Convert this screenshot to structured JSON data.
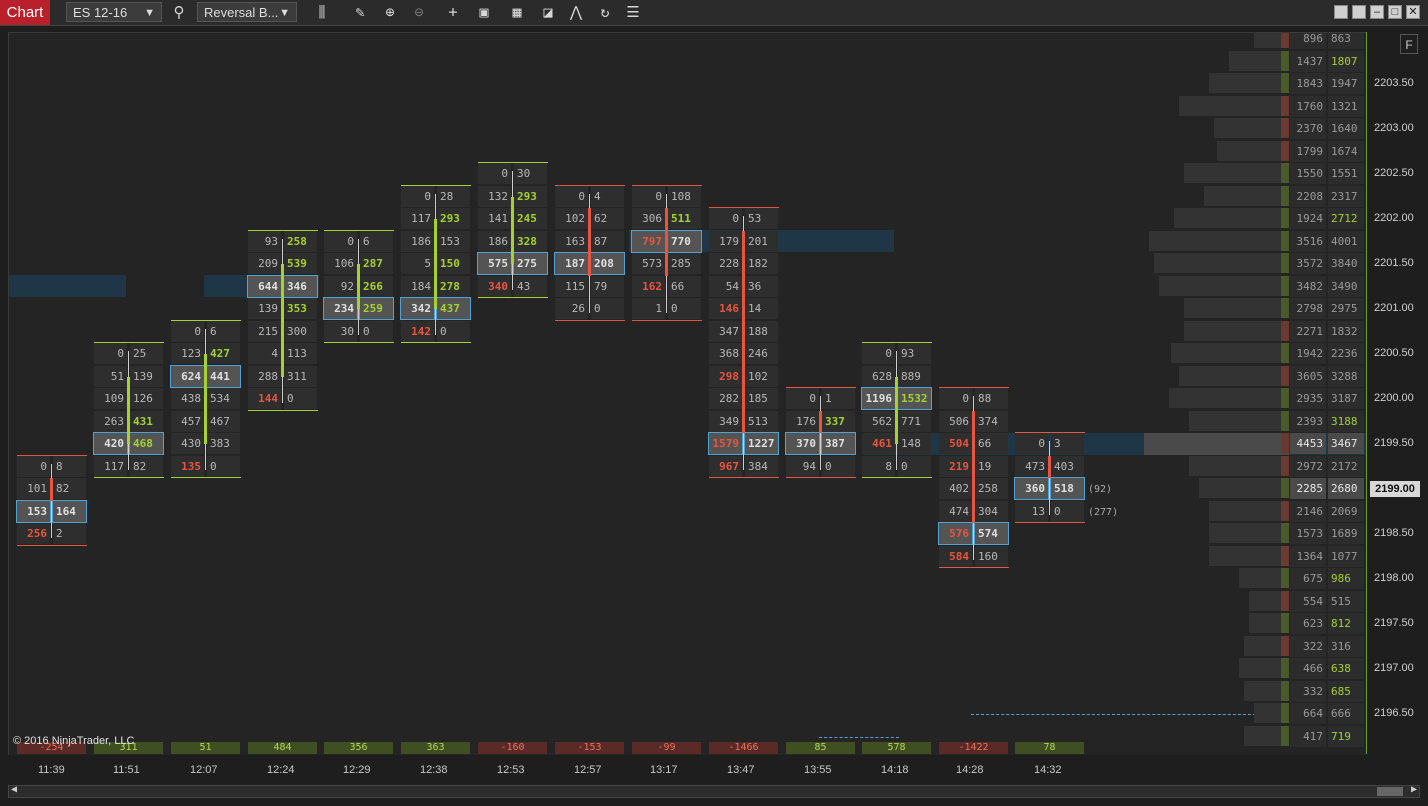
{
  "toolbar": {
    "tab_label": "Chart",
    "instrument": "ES 12-16",
    "bar_type": "Reversal B...",
    "tools": [
      "search-icon",
      "bar-chart-icon",
      "pencil-icon",
      "zoom-in-icon",
      "zoom-out-icon",
      "crosshair-icon",
      "data-box-icon",
      "chart-style-icon",
      "templates-icon",
      "strategy-icon",
      "reload-icon",
      "properties-icon"
    ]
  },
  "right_ctrl": {
    "f_label": "F"
  },
  "copyright": "© 2016 NinjaTrader, LLC",
  "current_price": "2199.00",
  "price_axis": [
    "2203.50",
    "2203.00",
    "2202.50",
    "2202.00",
    "2201.50",
    "2201.00",
    "2200.50",
    "2200.00",
    "2199.50",
    "2198.50",
    "2198.00",
    "2197.50",
    "2197.00",
    "2196.50"
  ],
  "annotations": [
    "(92)",
    "(277)"
  ],
  "colors": {
    "up": "#a6d12e",
    "down": "#e8553e",
    "poc_border": "#4fa2d1",
    "band": "#1e3a4c"
  },
  "bars": [
    {
      "time": "11:39",
      "delta": "-254",
      "dir": "down",
      "rows": [
        [
          "0",
          "8"
        ],
        [
          "101",
          "82"
        ],
        [
          "153",
          "164"
        ],
        [
          "256",
          "2"
        ]
      ],
      "poc": 2
    },
    {
      "time": "11:51",
      "delta": "311",
      "dir": "up",
      "rows": [
        [
          "0",
          "25"
        ],
        [
          "51",
          "139"
        ],
        [
          "109",
          "126"
        ],
        [
          "263",
          "431"
        ],
        [
          "420",
          "468"
        ],
        [
          "117",
          "82"
        ]
      ],
      "poc": 4
    },
    {
      "time": "12:07",
      "delta": "51",
      "dir": "up",
      "rows": [
        [
          "0",
          "6"
        ],
        [
          "123",
          "427"
        ],
        [
          "624",
          "441"
        ],
        [
          "438",
          "534"
        ],
        [
          "457",
          "467"
        ],
        [
          "430",
          "383"
        ],
        [
          "135",
          "0"
        ]
      ],
      "poc": 2
    },
    {
      "time": "12:24",
      "delta": "484",
      "dir": "up",
      "rows": [
        [
          "93",
          "258"
        ],
        [
          "209",
          "539"
        ],
        [
          "644",
          "346"
        ],
        [
          "139",
          "353"
        ],
        [
          "215",
          "300"
        ],
        [
          "4",
          "113"
        ],
        [
          "288",
          "311"
        ],
        [
          "144",
          "0"
        ]
      ],
      "poc": 2
    },
    {
      "time": "12:29",
      "delta": "356",
      "dir": "up",
      "rows": [
        [
          "0",
          "6"
        ],
        [
          "106",
          "287"
        ],
        [
          "92",
          "266"
        ],
        [
          "234",
          "259"
        ],
        [
          "30",
          "0"
        ]
      ],
      "poc": 3
    },
    {
      "time": "12:38",
      "delta": "363",
      "dir": "up",
      "rows": [
        [
          "0",
          "28"
        ],
        [
          "117",
          "293"
        ],
        [
          "186",
          "153"
        ],
        [
          "5",
          "150"
        ],
        [
          "184",
          "278"
        ],
        [
          "342",
          "437"
        ],
        [
          "142",
          "0"
        ]
      ],
      "poc": 5
    },
    {
      "time": "12:53",
      "delta": "-160",
      "dir": "up",
      "rows": [
        [
          "0",
          "30"
        ],
        [
          "132",
          "293"
        ],
        [
          "141",
          "245"
        ],
        [
          "186",
          "328"
        ],
        [
          "575",
          "275"
        ],
        [
          "340",
          "43"
        ]
      ],
      "poc": 4
    },
    {
      "time": "12:57",
      "delta": "-153",
      "dir": "down",
      "rows": [
        [
          "0",
          "4"
        ],
        [
          "102",
          "62"
        ],
        [
          "163",
          "87"
        ],
        [
          "187",
          "208"
        ],
        [
          "115",
          "79"
        ],
        [
          "26",
          "0"
        ]
      ],
      "poc": 3
    },
    {
      "time": "13:17",
      "delta": "-99",
      "dir": "down",
      "rows": [
        [
          "0",
          "108"
        ],
        [
          "306",
          "511"
        ],
        [
          "797",
          "770"
        ],
        [
          "573",
          "285"
        ],
        [
          "162",
          "66"
        ],
        [
          "1",
          "0"
        ]
      ],
      "poc": 2
    },
    {
      "time": "13:47",
      "delta": "-1466",
      "dir": "down",
      "rows": [
        [
          "0",
          "53"
        ],
        [
          "179",
          "201"
        ],
        [
          "228",
          "182"
        ],
        [
          "54",
          "36"
        ],
        [
          "146",
          "14"
        ],
        [
          "347",
          "188"
        ],
        [
          "368",
          "246"
        ],
        [
          "298",
          "102"
        ],
        [
          "282",
          "185"
        ],
        [
          "349",
          "513"
        ],
        [
          "1579",
          "1227"
        ],
        [
          "967",
          "384"
        ]
      ],
      "poc": 10
    },
    {
      "time": "13:55",
      "delta": "85",
      "dir": "down",
      "rows": [
        [
          "0",
          "1"
        ],
        [
          "176",
          "337"
        ],
        [
          "370",
          "387"
        ],
        [
          "94",
          "0"
        ]
      ],
      "poc": 2
    },
    {
      "time": "14:18",
      "delta": "578",
      "dir": "up",
      "rows": [
        [
          "0",
          "93"
        ],
        [
          "628",
          "889"
        ],
        [
          "1196",
          "1532"
        ],
        [
          "562",
          "771"
        ],
        [
          "461",
          "148"
        ],
        [
          "8",
          "0"
        ]
      ],
      "poc": 2
    },
    {
      "time": "14:28",
      "delta": "-1422",
      "dir": "down",
      "rows": [
        [
          "0",
          "88"
        ],
        [
          "506",
          "374"
        ],
        [
          "504",
          "66"
        ],
        [
          "219",
          "19"
        ],
        [
          "402",
          "258"
        ],
        [
          "474",
          "304"
        ],
        [
          "576",
          "574"
        ],
        [
          "584",
          "160"
        ]
      ],
      "poc": 6
    },
    {
      "time": "14:32",
      "delta": "78",
      "dir": "down",
      "rows": [
        [
          "0",
          "3"
        ],
        [
          "473",
          "403"
        ],
        [
          "360",
          "518"
        ],
        [
          "13",
          "0"
        ]
      ],
      "poc": 2
    }
  ],
  "ladder": [
    [
      "896",
      "863"
    ],
    [
      "1437",
      "1807"
    ],
    [
      "1843",
      "1947"
    ],
    [
      "1760",
      "1321"
    ],
    [
      "2370",
      "1640"
    ],
    [
      "1799",
      "1674"
    ],
    [
      "1550",
      "1551"
    ],
    [
      "2208",
      "2317"
    ],
    [
      "1924",
      "2712"
    ],
    [
      "3516",
      "4001"
    ],
    [
      "3572",
      "3840"
    ],
    [
      "3482",
      "3490"
    ],
    [
      "2798",
      "2975"
    ],
    [
      "2271",
      "1832"
    ],
    [
      "1942",
      "2236"
    ],
    [
      "3605",
      "3288"
    ],
    [
      "2935",
      "3187"
    ],
    [
      "2393",
      "3188"
    ],
    [
      "4453",
      "3467"
    ],
    [
      "2972",
      "2172"
    ],
    [
      "2285",
      "2680"
    ],
    [
      "2146",
      "2069"
    ],
    [
      "1573",
      "1689"
    ],
    [
      "1364",
      "1077"
    ],
    [
      "675",
      "986"
    ],
    [
      "554",
      "515"
    ],
    [
      "623",
      "812"
    ],
    [
      "322",
      "316"
    ],
    [
      "466",
      "638"
    ],
    [
      "332",
      "685"
    ],
    [
      "664",
      "666"
    ],
    [
      "417",
      "719"
    ]
  ]
}
